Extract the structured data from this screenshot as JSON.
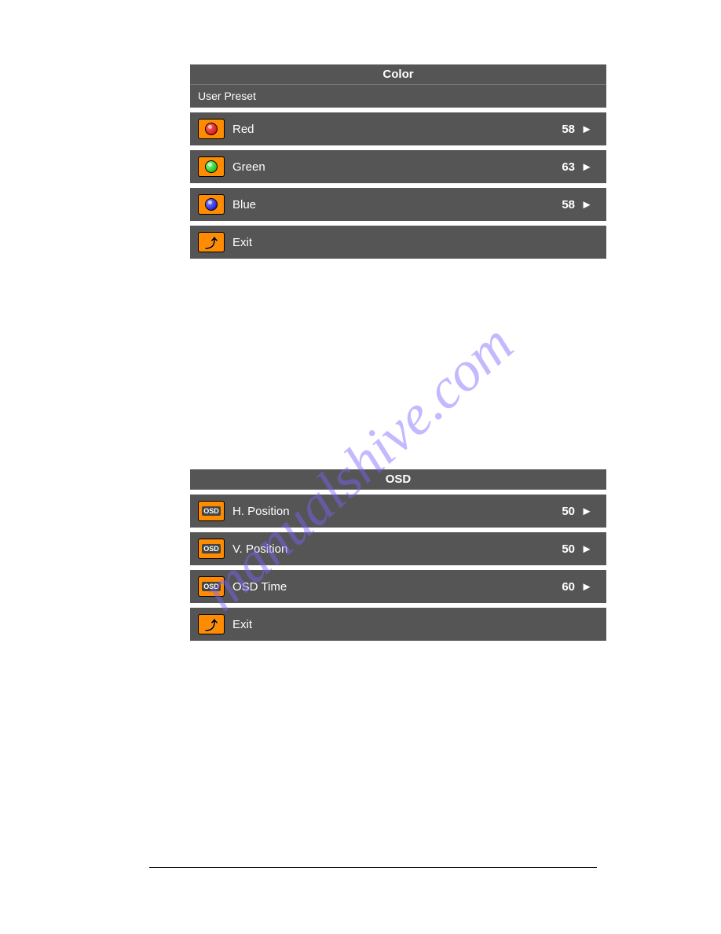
{
  "watermark_text": "manualshive.com",
  "color_menu": {
    "title": "Color",
    "subheading": "User Preset",
    "rows": [
      {
        "icon": "red-ball-icon",
        "label": "Red",
        "value": "58",
        "arrow": "►"
      },
      {
        "icon": "green-ball-icon",
        "label": "Green",
        "value": "63",
        "arrow": "►"
      },
      {
        "icon": "blue-ball-icon",
        "label": "Blue",
        "value": "58",
        "arrow": "►"
      },
      {
        "icon": "exit-icon",
        "label": "Exit",
        "value": "",
        "arrow": ""
      }
    ]
  },
  "osd_menu": {
    "title": "OSD",
    "rows": [
      {
        "icon": "osd-hpos-icon",
        "label": "H. Position",
        "value": "50",
        "arrow": "►"
      },
      {
        "icon": "osd-vpos-icon",
        "label": "V. Position",
        "value": "50",
        "arrow": "►"
      },
      {
        "icon": "osd-time-icon",
        "label": "OSD Time",
        "value": "60",
        "arrow": "►"
      },
      {
        "icon": "exit-icon",
        "label": "Exit",
        "value": "",
        "arrow": ""
      }
    ]
  }
}
